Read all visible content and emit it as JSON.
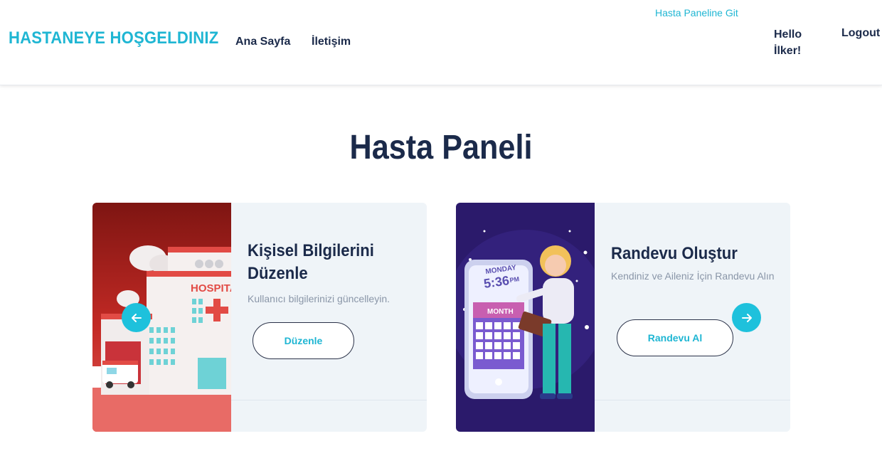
{
  "header": {
    "brand": "HASTANEYE HOŞGELDINIZ",
    "nav": {
      "home": "Ana Sayfa",
      "contact": "İletişim"
    },
    "panel_link": "Hasta Paneline Git",
    "hello": "Hello İlker!",
    "logout": "Logout"
  },
  "main": {
    "title": "Hasta Paneli",
    "cards": [
      {
        "title": "Kişisel Bilgilerini Düzenle",
        "description": "Kullanıcı bilgilerinizi güncelleyin.",
        "button": "Düzenle",
        "image_text": "HOSPITAL"
      },
      {
        "title": "Randevu Oluştur",
        "description": "Kendiniz ve Aileniz İçin Randevu Alın",
        "button": "Randevu Al",
        "image_text": {
          "day": "MONDAY",
          "time": "5:36",
          "ampm": "PM",
          "month": "MONTH"
        }
      }
    ]
  },
  "carousel": {
    "prev_icon": "arrow-left-icon",
    "next_icon": "arrow-right-icon"
  },
  "colors": {
    "accent": "#1fb6d3",
    "navy": "#1b2a4a",
    "card_bg": "#eff4f8"
  }
}
